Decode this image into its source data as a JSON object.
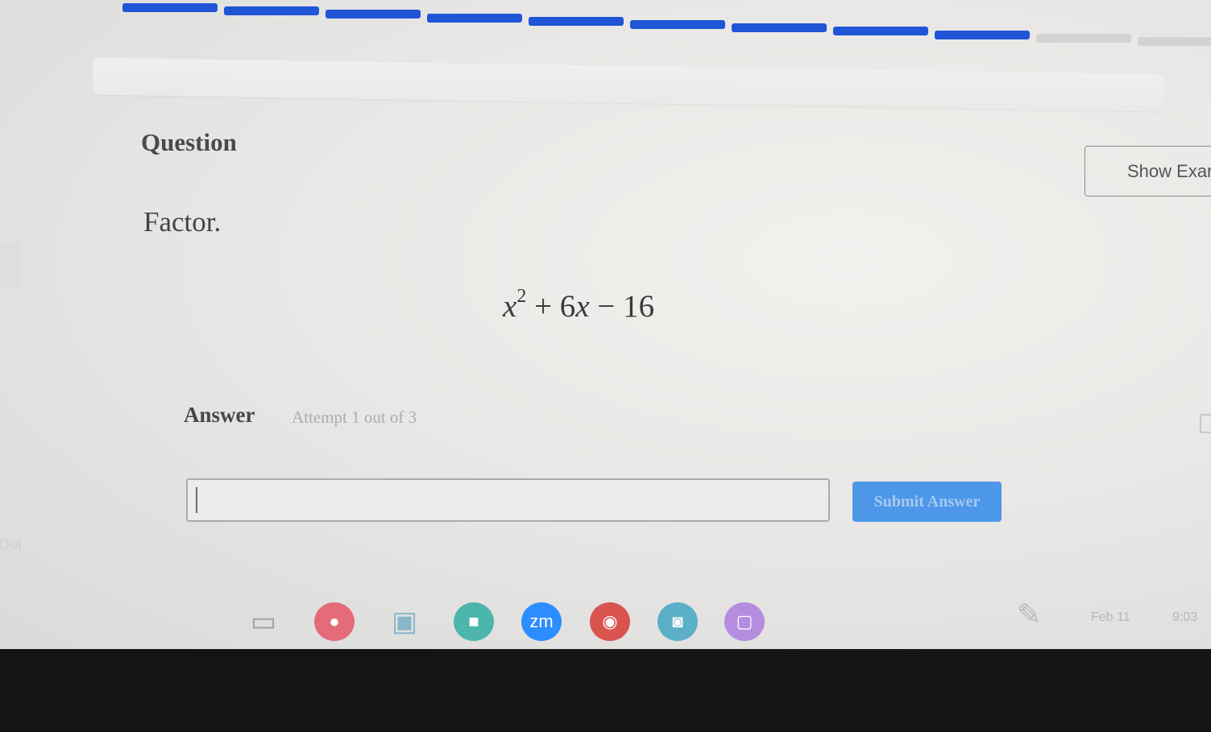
{
  "progress": {
    "segments_filled": 9,
    "segments_total": 11,
    "filled_color": "#1f55d6",
    "empty_color": "#d3d3d3"
  },
  "question": {
    "heading": "Question",
    "show_example_label": "Show Exar",
    "prompt": "Factor.",
    "expression": {
      "variable": "x",
      "exponent": "2",
      "rest": " + 6",
      "variable2": "x",
      "tail": " − 16"
    }
  },
  "answer": {
    "label": "Answer",
    "attempt_text": "Attempt 1 out of 3",
    "input_value": "",
    "submit_label": "Submit Answer",
    "submit_color": "#4d97e8"
  },
  "sidebar": {
    "out_label": "Out"
  },
  "shelf": {
    "apps": [
      {
        "name": "files-icon",
        "glyph": "▭",
        "color": "#9aa0a6"
      },
      {
        "name": "classroom-icon",
        "glyph": "●",
        "color": "#e56b7a"
      },
      {
        "name": "app-window-icon",
        "glyph": "▣",
        "color": "#8ab4c9"
      },
      {
        "name": "meet-icon",
        "glyph": "■",
        "color": "#4db6ac"
      },
      {
        "name": "zoom-icon",
        "glyph": "zm",
        "color": "#2d8cff"
      },
      {
        "name": "chrome-icon",
        "glyph": "◉",
        "color": "#d9534f"
      },
      {
        "name": "camera-icon",
        "glyph": "◙",
        "color": "#5bb0c8"
      },
      {
        "name": "purple-app-icon",
        "glyph": "▢",
        "color": "#b48de0"
      }
    ],
    "date": "Feb 11",
    "time": "9:03"
  }
}
